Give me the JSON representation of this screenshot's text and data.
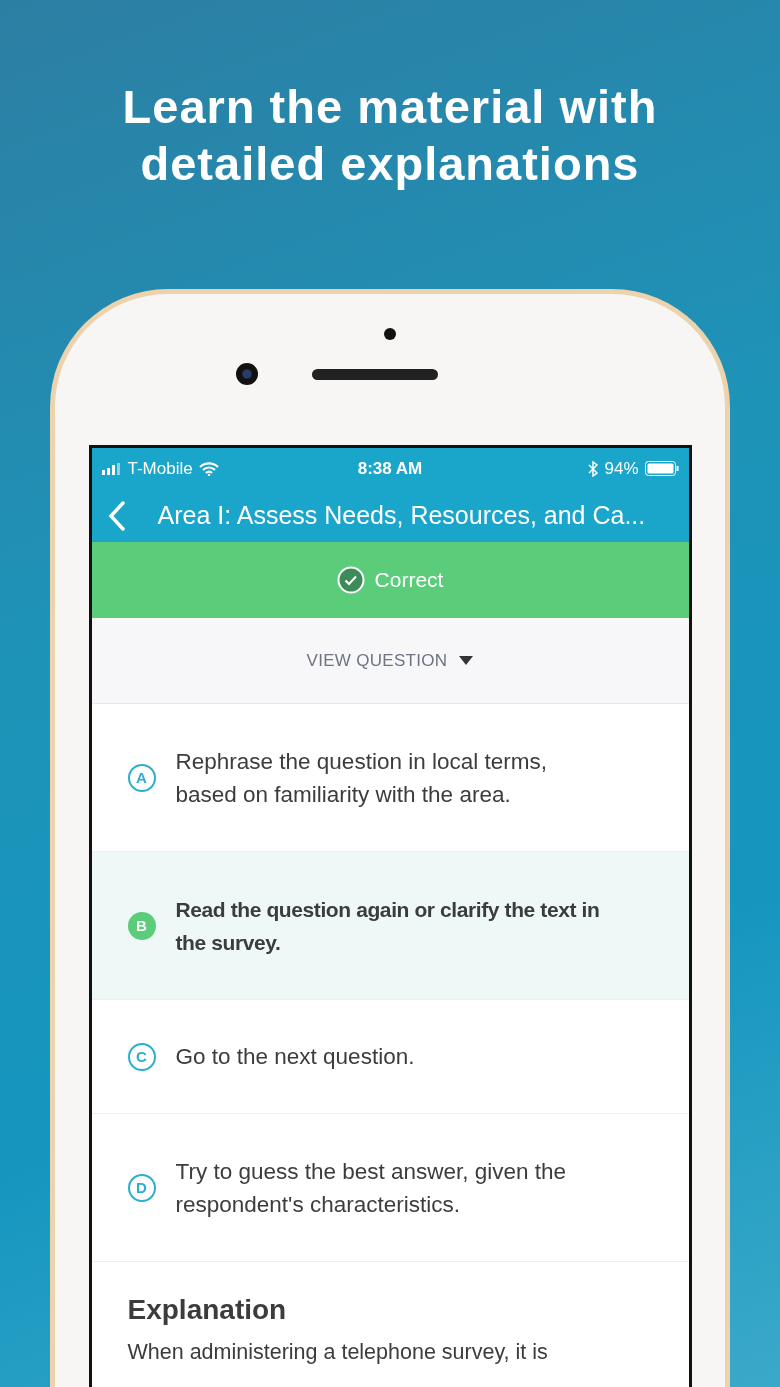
{
  "headline": [
    "Learn the material with",
    "detailed explanations"
  ],
  "status_bar": {
    "carrier": "T-Mobile",
    "time": "8:38 AM",
    "battery": "94%"
  },
  "nav": {
    "title": "Area I: Assess Needs, Resources, and Ca..."
  },
  "result_banner": {
    "label": "Correct"
  },
  "view_question": {
    "label": "VIEW QUESTION",
    "expanded": false
  },
  "options": [
    {
      "letter": "A",
      "text": "Rephrase the question in local terms, based on familiarity with the area.",
      "selected": false
    },
    {
      "letter": "B",
      "text": "Read the question again or clarify the text in the survey.",
      "selected": true
    },
    {
      "letter": "C",
      "text": "Go to the next question.",
      "selected": false
    },
    {
      "letter": "D",
      "text": "Try to guess the best answer, given the respondent's characteristics.",
      "selected": false
    }
  ],
  "explanation": {
    "title": "Explanation",
    "text": "When administering a telephone survey, it is"
  }
}
